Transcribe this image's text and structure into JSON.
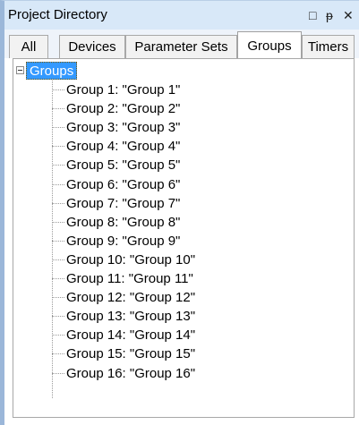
{
  "panel": {
    "title": "Project Directory",
    "icons": [
      "window-icon",
      "pin-icon",
      "close-icon"
    ],
    "window_glyph": "□",
    "pin_glyph": "ᵽ",
    "close_glyph": "✕"
  },
  "tabs": [
    {
      "label": "All"
    },
    {
      "label": "Devices"
    },
    {
      "label": "Parameter Sets"
    },
    {
      "label": "Groups",
      "active": true
    },
    {
      "label": "Timers"
    }
  ],
  "tree": {
    "root_label": "Groups",
    "items": [
      "Group 1: \"Group 1\"",
      "Group 2: \"Group 2\"",
      "Group 3: \"Group 3\"",
      "Group 4: \"Group 4\"",
      "Group 5: \"Group 5\"",
      "Group 6: \"Group 6\"",
      "Group 7: \"Group 7\"",
      "Group 8: \"Group 8\"",
      "Group 9: \"Group 9\"",
      "Group 10: \"Group 10\"",
      "Group 11: \"Group 11\"",
      "Group 12: \"Group 12\"",
      "Group 13: \"Group 13\"",
      "Group 14: \"Group 14\"",
      "Group 15: \"Group 15\"",
      "Group 16: \"Group 16\""
    ]
  },
  "colors": {
    "titlebar_bg": "#d8e8f8",
    "selection_bg": "#3399ff",
    "frame_accent": "#9bb7d9"
  }
}
